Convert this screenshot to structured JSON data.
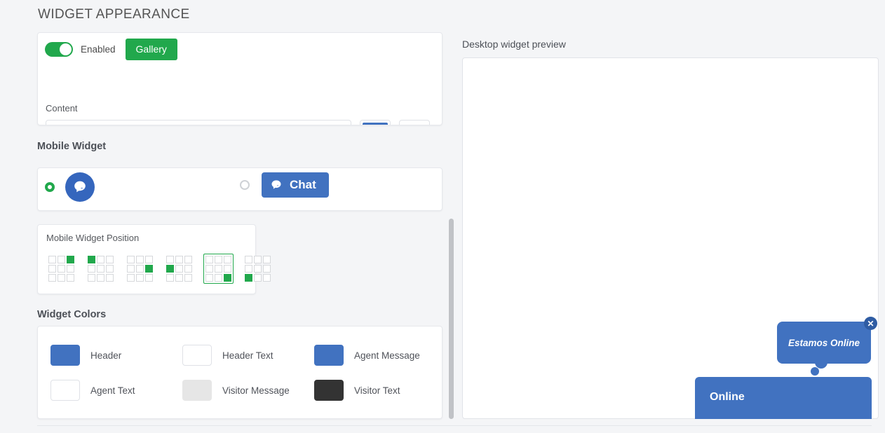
{
  "page": {
    "title": "WIDGET APPEARANCE"
  },
  "content_card": {
    "toggle_label": "Enabled",
    "toggle_state": "on",
    "gallery_label": "Gallery",
    "content_label": "Content",
    "content_value": "Estamos Online",
    "content_placeholder": "Content",
    "color_swatch": "#4172c0",
    "second_swatch": "#ffffff"
  },
  "mobile_widget": {
    "heading": "Mobile Widget",
    "options": [
      {
        "name": "round-bubble",
        "selected": true,
        "label": ""
      },
      {
        "name": "chat-pill",
        "selected": false,
        "label": "Chat"
      }
    ]
  },
  "position": {
    "label": "Mobile Widget Position",
    "selected_index": 4,
    "options": [
      {
        "name": "top-right",
        "cell": 2
      },
      {
        "name": "top-left",
        "cell": 0
      },
      {
        "name": "middle-right",
        "cell": 5
      },
      {
        "name": "middle-left",
        "cell": 3
      },
      {
        "name": "bottom-right",
        "cell": 8
      },
      {
        "name": "bottom-left",
        "cell": 6
      }
    ],
    "active_color": "#21a84c"
  },
  "widget_colors": {
    "heading": "Widget Colors",
    "items": [
      {
        "label": "Header",
        "color": "#4172c0"
      },
      {
        "label": "Header Text",
        "color": "#ffffff"
      },
      {
        "label": "Agent Message",
        "color": "#4172c0"
      },
      {
        "label": "Agent Text",
        "color": "#ffffff"
      },
      {
        "label": "Visitor Message",
        "color": "#e6e6e6"
      },
      {
        "label": "Visitor Text",
        "color": "#333333"
      }
    ]
  },
  "preview": {
    "label": "Desktop widget preview",
    "tooltip_text": "Estamos Online",
    "close_glyph": "✕",
    "header_title": "Online",
    "header_color": "#4172c0"
  },
  "theme": {
    "green": "#21a84c",
    "blue": "#4172c0",
    "page_bg": "#f4f5f7"
  }
}
